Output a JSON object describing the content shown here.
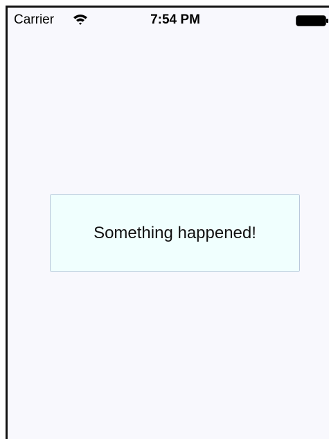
{
  "status_bar": {
    "carrier": "Carrier",
    "time": "7:54 PM",
    "wifi_icon": "wifi-icon",
    "battery_icon": "battery-icon"
  },
  "toast": {
    "message": "Something happened!",
    "background_color": "#f0fffe",
    "border_color": "#b8c7da"
  },
  "screen": {
    "background_color": "#f8f8fd"
  }
}
